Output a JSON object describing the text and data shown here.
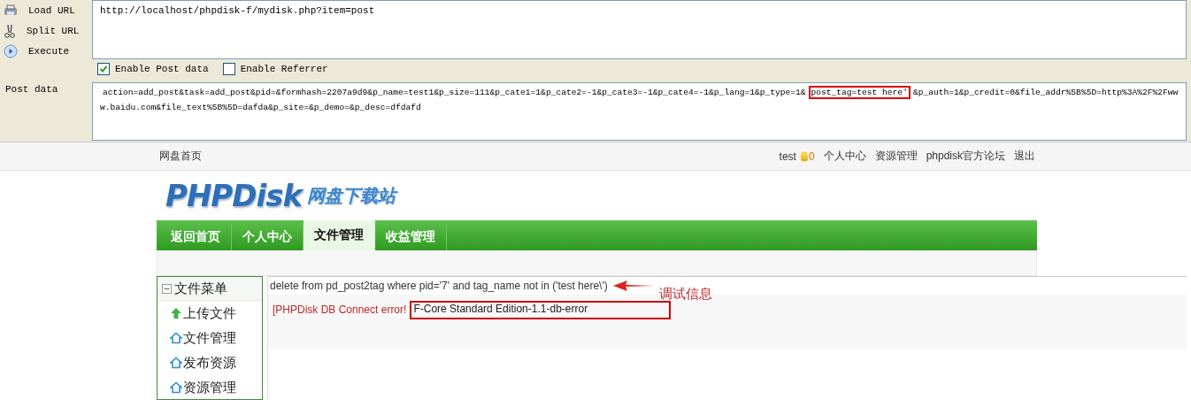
{
  "toolbar": {
    "actions": [
      {
        "label": "Load URL",
        "kind": "load"
      },
      {
        "label": "Split URL",
        "kind": "split"
      },
      {
        "label": "Execute",
        "kind": "execute"
      }
    ],
    "url": "http://localhost/phpdisk-f/mydisk.php?item=post",
    "options": [
      {
        "label": "Enable Post data",
        "checked": true
      },
      {
        "label": "Enable Referrer",
        "checked": false
      }
    ],
    "post_label": "Post data",
    "post_data": [
      {
        "text": "action=add_post&task=add_post&pid=&formhash=2207a9d9&p_name=test1&p_size=111&p_cate1=1&p_cate2=-1&p_cate3=-1&p_cate4=-1&p_lang=1&p_type=1&",
        "boxed": false
      },
      {
        "text": "post_tag=test here'",
        "boxed": true
      },
      {
        "text": "&p_auth=1&p_credit=0&file_addr%5B%5D=http%3A%2F%2Fwww.baidu.com&file_text%5B%5D=dafda&p_site=&p_demo=&p_desc=dfdafd",
        "boxed": false
      }
    ]
  },
  "site": {
    "home_link": "网盘首页",
    "user": "test",
    "coins": "0",
    "links": [
      "个人中心",
      "资源管理",
      "phpdisk官方论坛",
      "退出"
    ],
    "logo": "PHPDisk",
    "logo_subtitle": "网盘下载站",
    "nav": [
      {
        "label": "返回首页",
        "selected": false
      },
      {
        "label": "个人中心",
        "selected": false
      },
      {
        "label": "文件管理",
        "selected": true
      },
      {
        "label": "收益管理",
        "selected": false
      }
    ],
    "sidebar": {
      "title": "文件菜单",
      "expanded": true,
      "items": [
        {
          "label": "上传文件",
          "kind": "upload"
        },
        {
          "label": "文件管理",
          "kind": "home"
        },
        {
          "label": "发布资源",
          "kind": "home"
        },
        {
          "label": "资源管理",
          "kind": "home"
        }
      ]
    },
    "debug": "delete from pd_post2tag where pid='7' and tag_name not in ('test here\\')",
    "annotation": "调试信息",
    "error": {
      "prefix": "[PHPDisk DB Connect error!",
      "detail": "F-Core Standard Edition-1.1-db-error"
    }
  }
}
